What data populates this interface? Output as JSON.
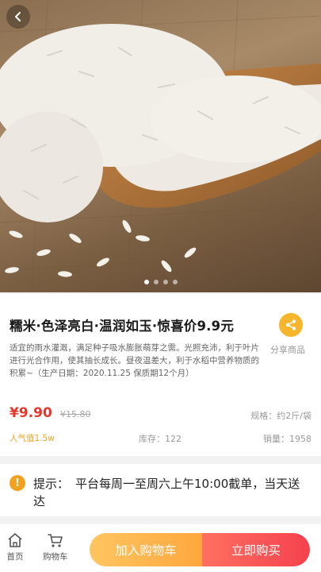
{
  "product": {
    "title": "糯米·色泽亮白·温润如玉·惊喜价9.9元",
    "description": "适宜的雨水灌溉，满足种子吸水膨胀萌芽之需。光照充沛，利于叶片进行光合作用，使其抽长成长。昼夜温差大，利于水稻中营养物质的积累~（生产日期：2020.11.25 保质期12个月）",
    "price": "¥9.90",
    "original_price": "¥15.80",
    "spec": "规格：约2斤/袋",
    "popularity": "人气值1.5w",
    "stock": "库存：122",
    "sales": "销量：1958",
    "share_label": "分享商品",
    "image_dots_total": 4,
    "image_dot_active": 0
  },
  "notice": {
    "label": "提示：",
    "text": "平台每周一至周六上午10:00截单，当天送达"
  },
  "bottom_nav": {
    "home_label": "首页",
    "cart_label": "购物车",
    "add_to_cart_label": "加入购物车",
    "buy_now_label": "立即购买"
  },
  "colors": {
    "price_red": "#e8362b",
    "popularity_orange": "#f0a020",
    "share_yellow": "#f7b52c",
    "add_btn_orange": "#ffa73d",
    "buy_btn_red": "#f5414e"
  }
}
